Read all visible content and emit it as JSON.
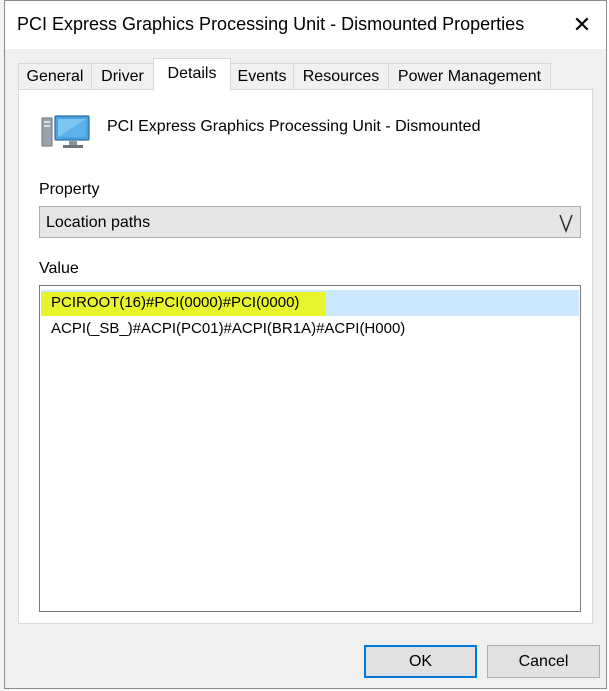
{
  "window": {
    "title": "PCI Express Graphics Processing Unit - Dismounted Properties",
    "close_glyph": "✕"
  },
  "tabs": [
    {
      "label": "General",
      "active": false
    },
    {
      "label": "Driver",
      "active": false
    },
    {
      "label": "Details",
      "active": true
    },
    {
      "label": "Events",
      "active": false
    },
    {
      "label": "Resources",
      "active": false
    },
    {
      "label": "Power Management",
      "active": false
    }
  ],
  "device": {
    "name": "PCI Express Graphics Processing Unit - Dismounted",
    "icon": "display-adapter-icon"
  },
  "property": {
    "label": "Property",
    "selected": "Location paths",
    "arrow_icon": "chevron-down-icon"
  },
  "value": {
    "label": "Value",
    "items": [
      {
        "text": "PCIROOT(16)#PCI(0000)#PCI(0000)",
        "selected": true,
        "highlighted": true
      },
      {
        "text": "ACPI(_SB_)#ACPI(PC01)#ACPI(BR1A)#ACPI(H000)",
        "selected": false,
        "highlighted": false
      }
    ]
  },
  "buttons": {
    "ok": "OK",
    "cancel": "Cancel"
  },
  "colors": {
    "selection": "#cce8ff",
    "highlighter": "#e8f52c",
    "default_button_border": "#0078d7"
  }
}
